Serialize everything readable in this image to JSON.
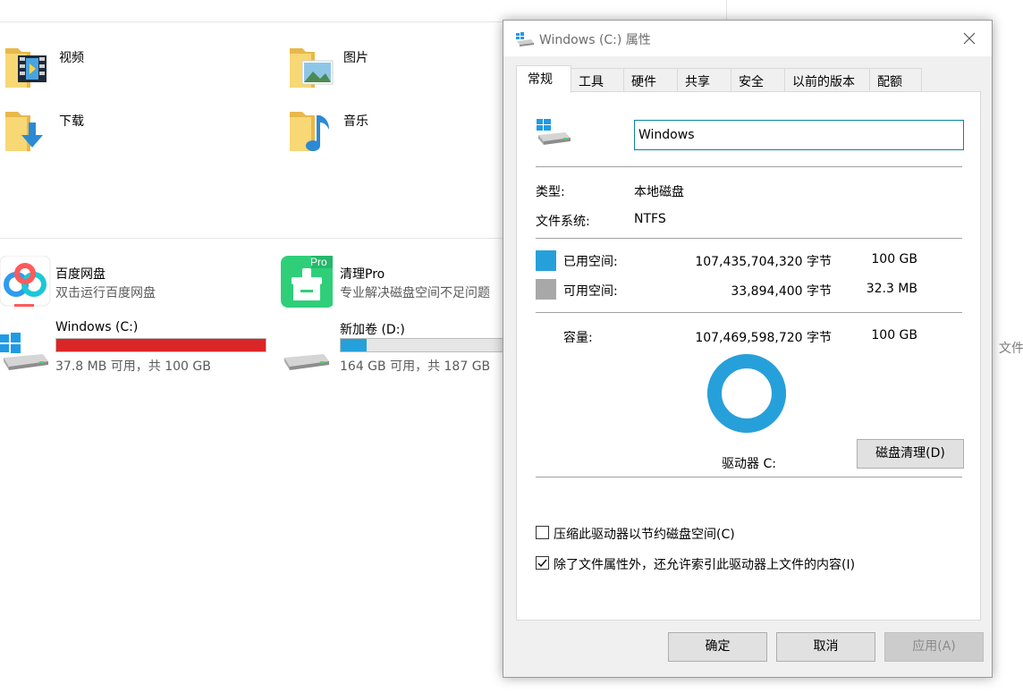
{
  "explorer": {
    "folders": [
      {
        "label": "视频",
        "icon": "video-folder-icon"
      },
      {
        "label": "图片",
        "icon": "pictures-folder-icon"
      },
      {
        "label": "下载",
        "icon": "downloads-folder-icon"
      },
      {
        "label": "音乐",
        "icon": "music-folder-icon"
      }
    ],
    "apps": [
      {
        "name": "百度网盘",
        "desc": "双击运行百度网盘",
        "icon": "baidu-netdisk-icon"
      },
      {
        "name": "清理Pro",
        "desc": "专业解决磁盘空间不足问题",
        "icon": "cleaner-pro-icon",
        "badge": "Pro"
      }
    ],
    "drives": [
      {
        "name": "Windows (C:)",
        "free": "37.8 MB 可用，共 100 GB",
        "used_fraction": 0.9996,
        "bar_color": "#da2626"
      },
      {
        "name": "新加卷 (D:)",
        "free": "164 GB 可用，共 187 GB",
        "used_fraction": 0.123,
        "bar_color": "#26a0da"
      }
    ],
    "edge_text": "文件"
  },
  "dialog": {
    "title": "Windows (C:) 属性",
    "tabs": [
      "常规",
      "工具",
      "硬件",
      "共享",
      "安全",
      "以前的版本",
      "配额"
    ],
    "active_tab": "常规",
    "drive_name_value": "Windows",
    "type_label": "类型:",
    "type_value": "本地磁盘",
    "fs_label": "文件系统:",
    "fs_value": "NTFS",
    "used_label": "已用空间:",
    "used_bytes": "107,435,704,320 字节",
    "used_size": "100 GB",
    "free_label": "可用空间:",
    "free_bytes": "33,894,400 字节",
    "free_size": "32.3 MB",
    "capacity_label": "容量:",
    "capacity_bytes": "107,469,598,720 字节",
    "capacity_size": "100 GB",
    "used_fraction": 0.99968,
    "used_color": "#26a0da",
    "free_color": "#a8a8a8",
    "drive_label": "驱动器 C:",
    "cleanup_button": "磁盘清理(D)",
    "compress_label": "压缩此驱动器以节约磁盘空间(C)",
    "compress_checked": false,
    "index_label": "除了文件属性外，还允许索引此驱动器上文件的内容(I)",
    "index_checked": true,
    "ok_button": "确定",
    "cancel_button": "取消",
    "apply_button": "应用(A)"
  }
}
